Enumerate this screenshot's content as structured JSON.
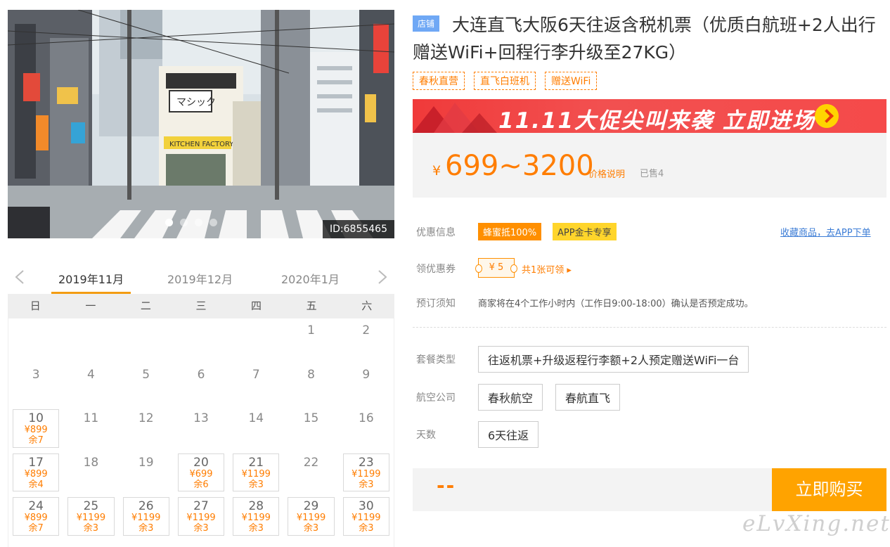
{
  "hero": {
    "image_id": "ID:6855465",
    "shop_sign": "マシック",
    "shop_sub": "KITCHEN FACTORY"
  },
  "calendar": {
    "months": [
      "2019年11月",
      "2019年12月",
      "2020年1月"
    ],
    "weekdays": [
      "日",
      "一",
      "二",
      "三",
      "四",
      "五",
      "六"
    ],
    "days": [
      {
        "d": "",
        "p": "",
        "s": ""
      },
      {
        "d": "",
        "p": "",
        "s": ""
      },
      {
        "d": "",
        "p": "",
        "s": ""
      },
      {
        "d": "",
        "p": "",
        "s": ""
      },
      {
        "d": "",
        "p": "",
        "s": ""
      },
      {
        "d": "1",
        "p": "",
        "s": ""
      },
      {
        "d": "2",
        "p": "",
        "s": ""
      },
      {
        "d": "3",
        "p": "",
        "s": ""
      },
      {
        "d": "4",
        "p": "",
        "s": ""
      },
      {
        "d": "5",
        "p": "",
        "s": ""
      },
      {
        "d": "6",
        "p": "",
        "s": ""
      },
      {
        "d": "7",
        "p": "",
        "s": ""
      },
      {
        "d": "8",
        "p": "",
        "s": ""
      },
      {
        "d": "9",
        "p": "",
        "s": ""
      },
      {
        "d": "10",
        "p": "¥899",
        "s": "余7"
      },
      {
        "d": "11",
        "p": "",
        "s": ""
      },
      {
        "d": "12",
        "p": "",
        "s": ""
      },
      {
        "d": "13",
        "p": "",
        "s": ""
      },
      {
        "d": "14",
        "p": "",
        "s": ""
      },
      {
        "d": "15",
        "p": "",
        "s": ""
      },
      {
        "d": "16",
        "p": "",
        "s": ""
      },
      {
        "d": "17",
        "p": "¥899",
        "s": "余4"
      },
      {
        "d": "18",
        "p": "",
        "s": ""
      },
      {
        "d": "19",
        "p": "",
        "s": ""
      },
      {
        "d": "20",
        "p": "¥699",
        "s": "余6"
      },
      {
        "d": "21",
        "p": "¥1199",
        "s": "余3"
      },
      {
        "d": "22",
        "p": "",
        "s": ""
      },
      {
        "d": "23",
        "p": "¥1199",
        "s": "余3"
      },
      {
        "d": "24",
        "p": "¥899",
        "s": "余7"
      },
      {
        "d": "25",
        "p": "¥1199",
        "s": "余3"
      },
      {
        "d": "26",
        "p": "¥1199",
        "s": "余3"
      },
      {
        "d": "27",
        "p": "¥1199",
        "s": "余3"
      },
      {
        "d": "28",
        "p": "¥1199",
        "s": "余3"
      },
      {
        "d": "29",
        "p": "¥1199",
        "s": "余3"
      },
      {
        "d": "30",
        "p": "¥1199",
        "s": "余3"
      }
    ]
  },
  "product": {
    "shop_badge": "店铺",
    "title": "大连直飞大阪6天往返含税机票（优质白航班+2人出行赠送WiFi+回程行李升级至27KG）",
    "tags": [
      "春秋直营",
      "直飞白班机",
      "赠送WiFi"
    ]
  },
  "promo": {
    "text": "11.11大促尖叫来袭 立即进场"
  },
  "price": {
    "currency": "¥",
    "range": "699~3200",
    "explain": "价格说明",
    "sold": "已售4"
  },
  "info": {
    "discount_label": "优惠信息",
    "badge1": "蜂蜜抵100%",
    "badge2": "APP金卡专享",
    "favorite_link": "收藏商品，去APP下单",
    "coupon_label": "领优惠券",
    "coupon_value": "¥ 5",
    "coupon_count": "共1张可领 ▸",
    "notice_label": "预订须知",
    "notice_text": "商家将在4个工作小时内（工作日9:00-18:00）确认是否预定成功。"
  },
  "options": {
    "package_label": "套餐类型",
    "package": "往返机票+升级返程行李额+2人预定赠送WiFi一台",
    "airline_label": "航空公司",
    "airlines": [
      "春秋航空",
      "春航直飞"
    ],
    "days_label": "天数",
    "days": "6天往返"
  },
  "buy": {
    "price": "--",
    "button": "立即购买"
  },
  "watermark": "eLvXing.net",
  "colors": {
    "accent": "#ff7d00",
    "buy_button": "#ffa300",
    "promo_red": "#f03a3a",
    "shop_badge": "#6fa8f5"
  }
}
